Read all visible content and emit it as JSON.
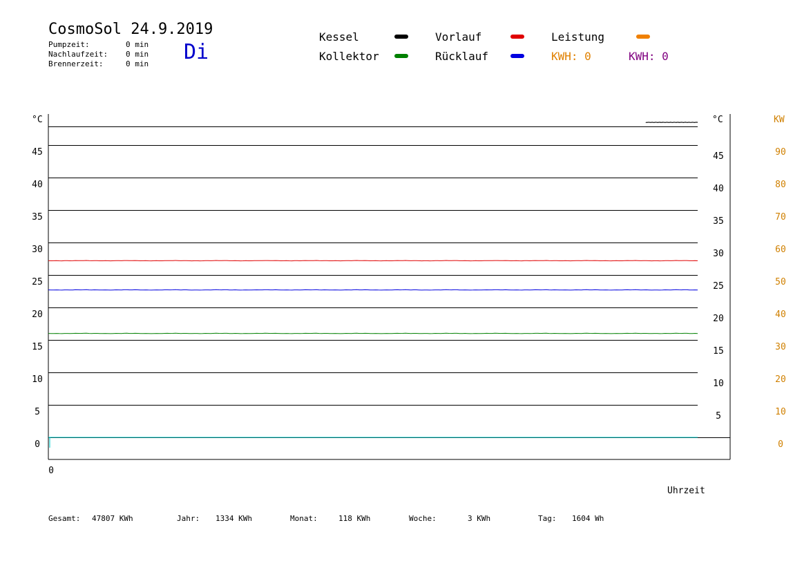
{
  "header": {
    "title": "CosmoSol 24.9.2019",
    "day": "Di",
    "times": [
      {
        "label": "Pumpzeit:",
        "value": "0 min"
      },
      {
        "label": "Nachlaufzeit:",
        "value": "0 min"
      },
      {
        "label": "Brennerzeit:",
        "value": "0 min"
      }
    ]
  },
  "legend": {
    "kessel": {
      "label": "Kessel",
      "color": "#000000"
    },
    "kollektor": {
      "label": "Kollektor",
      "color": "#008000"
    },
    "vorlauf": {
      "label": "Vorlauf",
      "color": "#e00000"
    },
    "ruecklauf": {
      "label": "Rücklauf",
      "color": "#0000e0"
    },
    "leistung": {
      "label": "Leistung",
      "color": "#f08000"
    },
    "kwh1": {
      "label": "KWH: 0",
      "color": "#e08000"
    },
    "kwh2": {
      "label": "KWH: 0",
      "color": "#800080"
    }
  },
  "footer": {
    "gesamt": {
      "label": "Gesamt:",
      "value": "47807 KWh"
    },
    "jahr": {
      "label": "Jahr:",
      "value": "1334 KWh"
    },
    "monat": {
      "label": "Monat:",
      "value": "118 KWh"
    },
    "woche": {
      "label": "Woche:",
      "value": "3 KWh"
    },
    "tag": {
      "label": "Tag:",
      "value": "1604 Wh"
    }
  },
  "chart_data": {
    "type": "line",
    "ylabel_left": "°C",
    "ylabel_right": "°C",
    "ylabel_far_right": "KW",
    "xlabel": "Uhrzeit",
    "x_tick_labels": [
      "0"
    ],
    "ylim": [
      0,
      50
    ],
    "y_ticks": [
      0,
      5,
      10,
      15,
      20,
      25,
      30,
      35,
      40,
      45
    ],
    "kw_ylim": [
      0,
      100
    ],
    "kw_ticks": [
      0,
      10,
      20,
      30,
      40,
      50,
      60,
      70,
      80,
      90
    ],
    "grid": true,
    "series": [
      {
        "name": "Kessel",
        "color": "#000000",
        "value": 48.5,
        "x_start": 0.92
      },
      {
        "name": "Vorlauf",
        "color": "#e00000",
        "value": 27.2
      },
      {
        "name": "Rücklauf",
        "color": "#0000e0",
        "value": 22.7
      },
      {
        "name": "Kollektor",
        "color": "#008000",
        "value": 16.0
      },
      {
        "name": "Leistung",
        "color": "#00d0d0",
        "value": 0.0
      }
    ]
  }
}
